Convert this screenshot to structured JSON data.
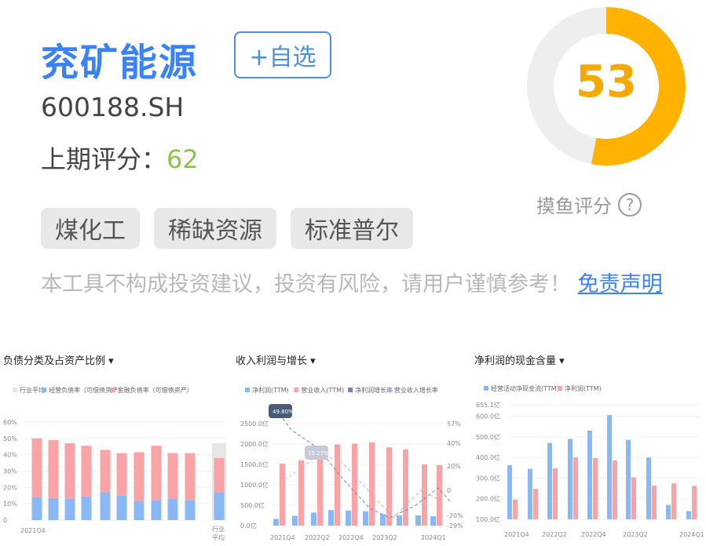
{
  "stock": {
    "name": "兖矿能源",
    "code": "600188.SH",
    "add_label": "+自选",
    "last_score_label": "上期评分：",
    "last_score_value": "62",
    "tags": [
      "煤化工",
      "稀缺资源",
      "标准普尔"
    ],
    "disclaimer": "本工具不构成投资建议，投资有风险，请用户谨慎参考！",
    "disclaimer_link": "免责声明"
  },
  "score": {
    "value": 53,
    "max": 100,
    "label": "摸鱼评分",
    "help_symbol": "?",
    "colors": {
      "fill": "#ffb300",
      "track": "#eeeeee",
      "text": "#f5a800"
    }
  },
  "colors": {
    "brand_blue": "#3b82f6",
    "bar_blue": "#8ab8f5",
    "bar_red": "#f8a3a6",
    "gray": "#e6e6e6",
    "good_green": "#8bc34a"
  },
  "chart_data": [
    {
      "type": "bar",
      "title": "负债分类及占资产比例",
      "legend": [
        "行业平均",
        "经营负债率（可偿债资产）",
        "金融负债率（可偿债资产）"
      ],
      "stacked": true,
      "categories": [
        "2021Q4",
        "",
        "",
        "",
        "",
        "",
        "",
        "",
        "",
        "",
        "行业平均"
      ],
      "series": [
        {
          "name": "经营负债率（可偿债资产）",
          "values": [
            14,
            13.5,
            13,
            14.5,
            17,
            15,
            11.5,
            12,
            13,
            12,
            17
          ]
        },
        {
          "name": "金融负债率（可偿债资产）",
          "values": [
            36,
            35.5,
            34,
            31,
            26,
            26,
            30,
            33.5,
            28,
            29,
            21
          ]
        }
      ],
      "industry_avg_total": 47,
      "yticks": [
        "60%",
        "50%",
        "40%",
        "30%",
        "20%",
        "10%",
        "0"
      ],
      "ylim": [
        0,
        60
      ],
      "xlabels": [
        "2021Q4",
        "行业\n平均"
      ]
    },
    {
      "type": "bar",
      "title": "收入利润与增长",
      "legend": [
        "净利润(TTM)",
        "营业收入(TTM)",
        "净利润增长率",
        "营业收入增长率"
      ],
      "categories": [
        "2021Q4",
        "",
        "2022Q2",
        "",
        "2022Q4",
        "",
        "2023Q2",
        "",
        "",
        "2024Q1"
      ],
      "series": [
        {
          "name": "净利润(TTM)",
          "values": [
            165,
            240,
            320,
            380,
            370,
            350,
            280,
            250,
            250,
            230
          ]
        },
        {
          "name": "营业收入(TTM)",
          "values": [
            1520,
            1600,
            1680,
            1990,
            2010,
            2040,
            1920,
            1870,
            1500,
            1480
          ]
        }
      ],
      "yticks_left": [
        "2500.0亿",
        "2000.0亿",
        "1500.0亿",
        "1000.0亿",
        "500.0亿",
        "0.0亿"
      ],
      "ylim": [
        0,
        2500
      ],
      "yticks_right": [
        "57%",
        "40%",
        "20%",
        "0",
        "-20%",
        "-29%"
      ],
      "tooltips": [
        "49.80%",
        "15.27%"
      ],
      "xlabels": [
        "2021Q4",
        "2022Q2",
        "2022Q4",
        "2023Q2",
        "2024Q1"
      ]
    },
    {
      "type": "bar",
      "title": "净利润的现金含量",
      "legend": [
        "经营活动净现金流(TTM)",
        "净利润(TTM)"
      ],
      "categories": [
        "2021Q4",
        "",
        "2022Q2",
        "",
        "2022Q4",
        "",
        "2023Q2",
        "",
        "",
        "2024Q1"
      ],
      "series": [
        {
          "name": "经营活动净现金流(TTM)",
          "values": [
            362,
            345,
            470,
            490,
            530,
            605,
            485,
            400,
            170,
            140
          ]
        },
        {
          "name": "净利润(TTM)",
          "values": [
            195,
            248,
            347,
            400,
            397,
            385,
            303,
            263,
            274,
            262
          ]
        }
      ],
      "yticks": [
        "655.1亿",
        "600.0亿",
        "500.0亿",
        "400.0亿",
        "300.0亿",
        "200.0亿",
        "100.0亿"
      ],
      "ylim": [
        100,
        655.1
      ],
      "xlabels": [
        "2021Q4",
        "2022Q2",
        "2022Q4",
        "2023Q2",
        "2024Q1"
      ]
    }
  ]
}
